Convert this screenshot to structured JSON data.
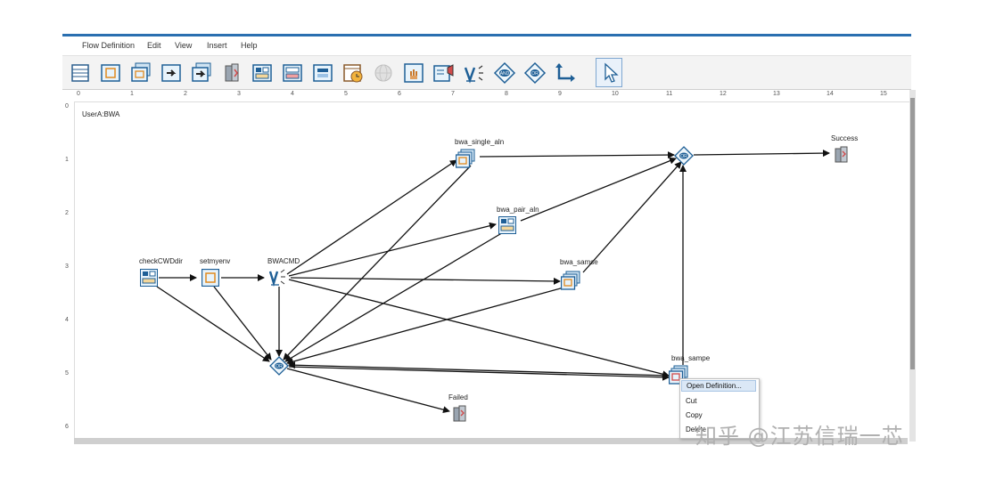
{
  "menu": {
    "items": [
      "Flow Definition",
      "Edit",
      "View",
      "Insert",
      "Help"
    ]
  },
  "toolbar": {
    "buttons": [
      "table-icon",
      "job-icon",
      "multi-job-icon",
      "job-forward-icon",
      "multi-forward-icon",
      "server-icon",
      "panel-icon",
      "panel-link-icon",
      "panel-stack-icon",
      "clock-icon",
      "globe-icon",
      "hand-icon",
      "message-icon",
      "variable-icon",
      "and-icon",
      "or-icon",
      "connector-icon",
      "pointer-icon"
    ]
  },
  "ruler": {
    "horizontal": [
      "0",
      "1",
      "2",
      "3",
      "4",
      "5",
      "6",
      "7",
      "8",
      "9",
      "10",
      "11",
      "12",
      "13",
      "14",
      "15"
    ],
    "vertical": [
      "0",
      "1",
      "2",
      "3",
      "4",
      "5",
      "6"
    ]
  },
  "workflow": {
    "title": "UserA:BWA",
    "nodes": {
      "checkcwddir": "checkCWDdir",
      "setmyenv": "setmyenv",
      "bwacmd": "BWACMD",
      "or_left": "OR",
      "failed": "Failed",
      "bwa_single_aln": "bwa_single_aln",
      "bwa_pair_aln": "bwa_pair_aln",
      "bwa_samse": "bwa_samse",
      "bwa_sampe": "bwa_sampe",
      "or_right": "OR",
      "success": "Success"
    }
  },
  "context_menu": {
    "open": "Open Definition...",
    "cut": "Cut",
    "copy": "Copy",
    "delete": "Delete"
  },
  "watermark": "知乎 @江苏信瑞一芯",
  "colors": {
    "accent": "#2a6fb0",
    "selection": "#dbe8f6",
    "edge": "#111111"
  }
}
